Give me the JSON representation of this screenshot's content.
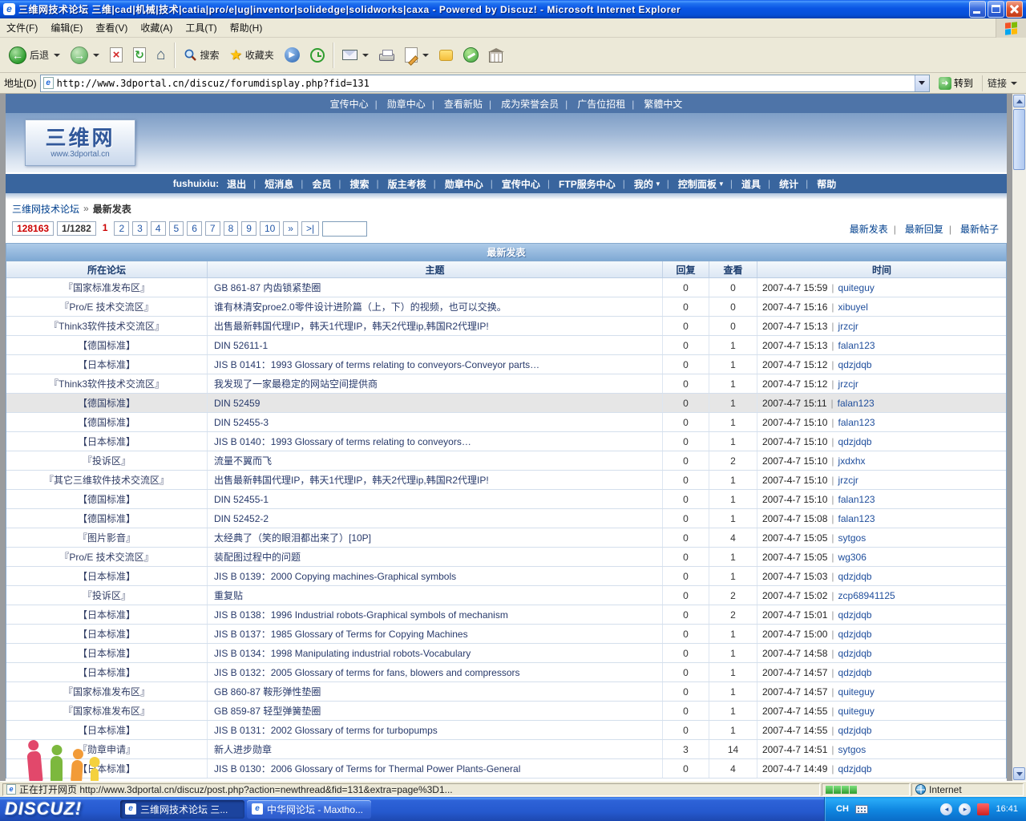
{
  "window": {
    "title": "三维网技术论坛 三维|cad|机械|技术|catia|pro/e|ug|inventor|solidedge|solidworks|caxa - Powered by Discuz! - Microsoft Internet Explorer"
  },
  "menu": {
    "items": [
      "文件(F)",
      "编辑(E)",
      "查看(V)",
      "收藏(A)",
      "工具(T)",
      "帮助(H)"
    ]
  },
  "toolbar": {
    "back": "后退",
    "search": "搜索",
    "favorites": "收藏夹"
  },
  "address": {
    "label": "地址(D)",
    "url": "http://www.3dportal.cn/discuz/forumdisplay.php?fid=131",
    "go": "转到",
    "links": "链接"
  },
  "site": {
    "top_links": [
      "宣传中心",
      "勋章中心",
      "查看新贴",
      "成为荣誉会员",
      "广告位招租",
      "繁體中文"
    ],
    "logo": {
      "text": "三维网",
      "url": "www.3dportal.cn"
    },
    "user_prefix": "fushuixiu:",
    "user_links": [
      {
        "label": "退出",
        "caret": ""
      },
      {
        "label": "短消息",
        "caret": ""
      },
      {
        "label": "会员",
        "caret": ""
      },
      {
        "label": "搜索",
        "caret": ""
      },
      {
        "label": "版主考核",
        "caret": ""
      },
      {
        "label": "勋章中心",
        "caret": ""
      },
      {
        "label": "宣传中心",
        "caret": ""
      },
      {
        "label": "FTP服务中心",
        "caret": ""
      },
      {
        "label": "我的",
        "caret": "▼"
      },
      {
        "label": "控制面板",
        "caret": "▼"
      },
      {
        "label": "道具",
        "caret": ""
      },
      {
        "label": "统计",
        "caret": ""
      },
      {
        "label": "帮助",
        "caret": ""
      }
    ],
    "breadcrumb": {
      "root": "三维网技术论坛",
      "sep": "»",
      "current": "最新发表"
    },
    "pagination": {
      "total": "128163",
      "ratio": "1/1282",
      "pages": [
        {
          "label": "1",
          "css": "current"
        },
        {
          "label": "2"
        },
        {
          "label": "3"
        },
        {
          "label": "4"
        },
        {
          "label": "5"
        },
        {
          "label": "6"
        },
        {
          "label": "7"
        },
        {
          "label": "8"
        },
        {
          "label": "9"
        },
        {
          "label": "10"
        }
      ],
      "next": "»",
      "last": ">|"
    },
    "view_links": [
      "最新发表",
      "最新回复",
      "最新帖子"
    ],
    "table": {
      "title": "最新发表",
      "columns": [
        "所在论坛",
        "主题",
        "回复",
        "查看",
        "时间"
      ],
      "rows": [
        {
          "forum": "『国家标准发布区』",
          "topic": "GB 861-87 内齿锁紧垫圈",
          "replies": "0",
          "views": "0",
          "time": "2007-4-7 15:59",
          "author": "quiteguy"
        },
        {
          "forum": "『Pro/E 技术交流区』",
          "topic": "谁有林清安proe2.0零件设计进阶篇（上，下）的视频，也可以交换。",
          "replies": "0",
          "views": "0",
          "time": "2007-4-7 15:16",
          "author": "xibuyel"
        },
        {
          "forum": "『Think3软件技术交流区』",
          "topic": "出售最新韩国代理IP，韩天1代理IP，韩天2代理ip,韩国R2代理IP!",
          "replies": "0",
          "views": "0",
          "time": "2007-4-7 15:13",
          "author": "jrzcjr"
        },
        {
          "forum": "【德国标准】",
          "topic": "DIN 52611-1",
          "replies": "0",
          "views": "1",
          "time": "2007-4-7 15:13",
          "author": "falan123"
        },
        {
          "forum": "【日本标准】",
          "topic": "JIS B 0141：1993 Glossary of terms relating to conveyors-Conveyor parts…",
          "replies": "0",
          "views": "1",
          "time": "2007-4-7 15:12",
          "author": "qdzjdqb"
        },
        {
          "forum": "『Think3软件技术交流区』",
          "topic": "我发现了一家最稳定的网站空间提供商",
          "replies": "0",
          "views": "1",
          "time": "2007-4-7 15:12",
          "author": "jrzcjr"
        },
        {
          "forum": "【德国标准】",
          "topic": "DIN 52459",
          "replies": "0",
          "views": "1",
          "time": "2007-4-7 15:11",
          "author": "falan123",
          "css": "hl"
        },
        {
          "forum": "【德国标准】",
          "topic": "DIN 52455-3",
          "replies": "0",
          "views": "1",
          "time": "2007-4-7 15:10",
          "author": "falan123"
        },
        {
          "forum": "【日本标准】",
          "topic": "JIS B 0140：1993 Glossary of terms relating to conveyors…",
          "replies": "0",
          "views": "1",
          "time": "2007-4-7 15:10",
          "author": "qdzjdqb"
        },
        {
          "forum": "『投诉区』",
          "topic": "流量不翼而飞",
          "replies": "0",
          "views": "2",
          "time": "2007-4-7 15:10",
          "author": "jxdxhx"
        },
        {
          "forum": "『其它三维软件技术交流区』",
          "topic": "出售最新韩国代理IP，韩天1代理IP，韩天2代理ip,韩国R2代理IP!",
          "replies": "0",
          "views": "1",
          "time": "2007-4-7 15:10",
          "author": "jrzcjr"
        },
        {
          "forum": "【德国标准】",
          "topic": "DIN 52455-1",
          "replies": "0",
          "views": "1",
          "time": "2007-4-7 15:10",
          "author": "falan123"
        },
        {
          "forum": "【德国标准】",
          "topic": "DIN 52452-2",
          "replies": "0",
          "views": "1",
          "time": "2007-4-7 15:08",
          "author": "falan123"
        },
        {
          "forum": "『图片影音』",
          "topic": "太经典了（笑的眼泪都出来了）[10P]",
          "replies": "0",
          "views": "4",
          "time": "2007-4-7 15:05",
          "author": "sytgos"
        },
        {
          "forum": "『Pro/E 技术交流区』",
          "topic": "装配图过程中的问题",
          "replies": "0",
          "views": "1",
          "time": "2007-4-7 15:05",
          "author": "wg306"
        },
        {
          "forum": "【日本标准】",
          "topic": "JIS B 0139：2000 Copying machines-Graphical symbols",
          "replies": "0",
          "views": "1",
          "time": "2007-4-7 15:03",
          "author": "qdzjdqb"
        },
        {
          "forum": "『投诉区』",
          "topic": "重复贴",
          "replies": "0",
          "views": "2",
          "time": "2007-4-7 15:02",
          "author": "zcp68941125"
        },
        {
          "forum": "【日本标准】",
          "topic": "JIS B 0138：1996 Industrial robots-Graphical symbols of mechanism",
          "replies": "0",
          "views": "2",
          "time": "2007-4-7 15:01",
          "author": "qdzjdqb"
        },
        {
          "forum": "【日本标准】",
          "topic": "JIS B 0137：1985 Glossary of Terms for Copying Machines",
          "replies": "0",
          "views": "1",
          "time": "2007-4-7 15:00",
          "author": "qdzjdqb"
        },
        {
          "forum": "【日本标准】",
          "topic": "JIS B 0134：1998 Manipulating industrial robots-Vocabulary",
          "replies": "0",
          "views": "1",
          "time": "2007-4-7 14:58",
          "author": "qdzjdqb"
        },
        {
          "forum": "【日本标准】",
          "topic": "JIS B 0132：2005 Glossary of terms for fans, blowers and compressors",
          "replies": "0",
          "views": "1",
          "time": "2007-4-7 14:57",
          "author": "qdzjdqb"
        },
        {
          "forum": "『国家标准发布区』",
          "topic": "GB 860-87 鞍形弹性垫圈",
          "replies": "0",
          "views": "1",
          "time": "2007-4-7 14:57",
          "author": "quiteguy"
        },
        {
          "forum": "『国家标准发布区』",
          "topic": "GB 859-87 轻型弹簧垫圈",
          "replies": "0",
          "views": "1",
          "time": "2007-4-7 14:55",
          "author": "quiteguy"
        },
        {
          "forum": "【日本标准】",
          "topic": "JIS B 0131：2002 Glossary of terms for turbopumps",
          "replies": "0",
          "views": "1",
          "time": "2007-4-7 14:55",
          "author": "qdzjdqb"
        },
        {
          "forum": "『勋章申请』",
          "topic": "新人进步勋章",
          "replies": "3",
          "views": "14",
          "time": "2007-4-7 14:51",
          "author": "sytgos"
        },
        {
          "forum": "【日本标准】",
          "topic": "JIS B 0130：2006 Glossary of Terms for Thermal Power Plants-General",
          "replies": "0",
          "views": "4",
          "time": "2007-4-7 14:49",
          "author": "qdzjdqb"
        }
      ]
    }
  },
  "status": {
    "text": "正在打开网页 http://www.3dportal.cn/discuz/post.php?action=newthread&fid=131&extra=page%3D1...",
    "zone": "Internet"
  },
  "taskbar": {
    "windows": [
      {
        "label": "三维网技术论坛 三...",
        "css": "active"
      },
      {
        "label": "中华网论坛 - Maxtho..."
      }
    ],
    "lang": "CH",
    "time": "16:41"
  },
  "discuz": {
    "logo": "DISCUZ!"
  }
}
